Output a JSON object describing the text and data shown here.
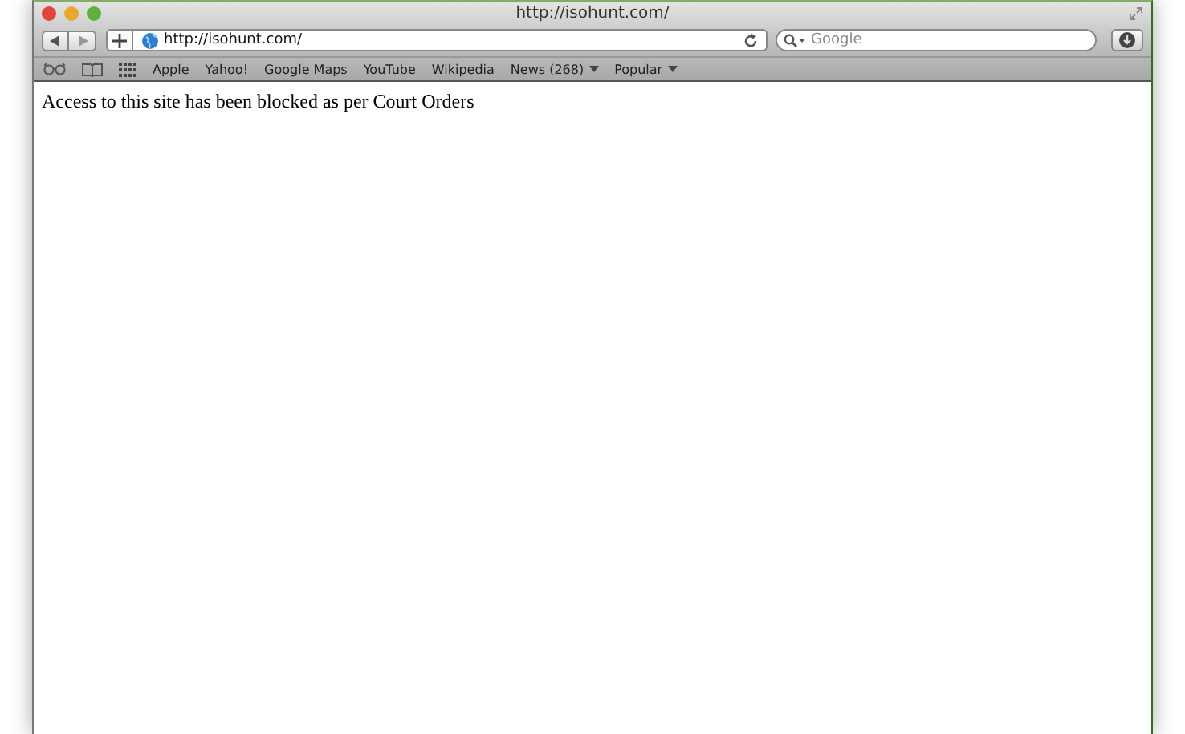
{
  "window": {
    "title": "http://isohunt.com/"
  },
  "toolbar": {
    "address": "http://isohunt.com/",
    "search": {
      "placeholder": "Google"
    }
  },
  "bookmarks": [
    {
      "label": "Apple",
      "menu": false
    },
    {
      "label": "Yahoo!",
      "menu": false
    },
    {
      "label": "Google Maps",
      "menu": false
    },
    {
      "label": "YouTube",
      "menu": false
    },
    {
      "label": "Wikipedia",
      "menu": false
    },
    {
      "label": "News (268)",
      "menu": true
    },
    {
      "label": "Popular",
      "menu": true
    }
  ],
  "page": {
    "message": "Access to this site has been blocked as per Court Orders"
  }
}
